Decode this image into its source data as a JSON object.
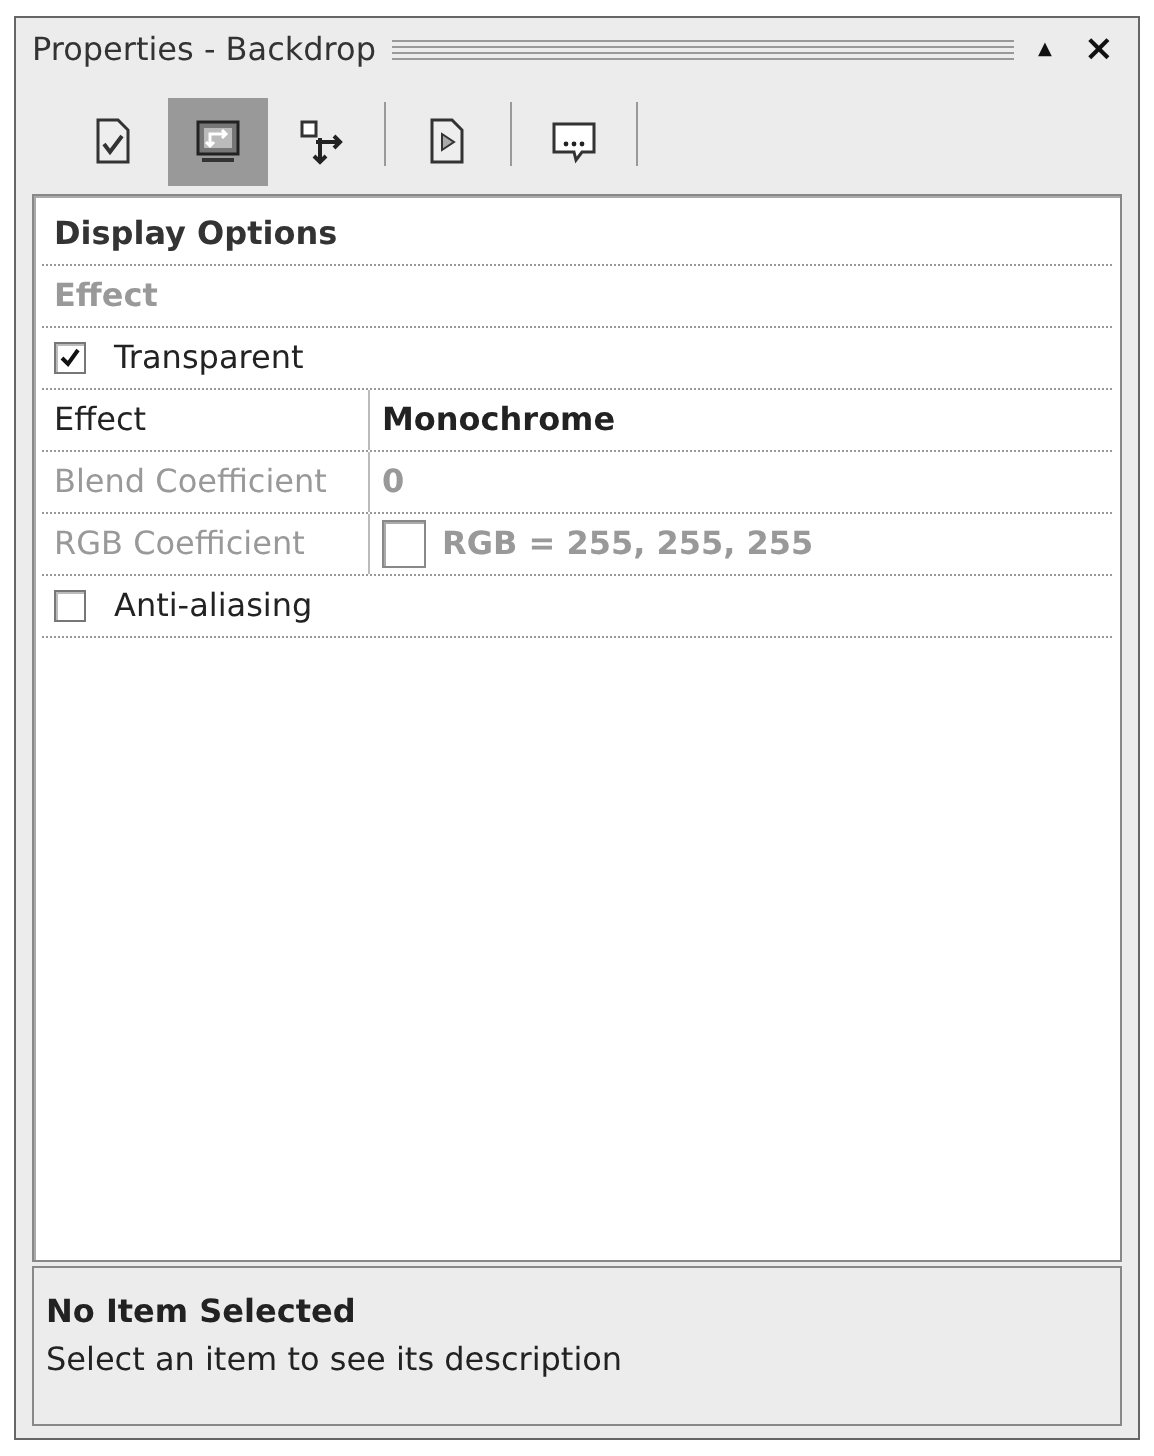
{
  "window": {
    "title": "Properties - Backdrop"
  },
  "title_buttons": [
    {
      "kind": "pin",
      "glyph": "▲"
    },
    {
      "kind": "close",
      "glyph": "×"
    }
  ],
  "toolbar": [
    {
      "kind": "doc-check",
      "selected": false
    },
    {
      "kind": "screen",
      "selected": true
    },
    {
      "kind": "move",
      "selected": false
    },
    {
      "kind": "doc-play",
      "selected": false
    },
    {
      "kind": "bubble",
      "selected": false
    }
  ],
  "grid": [
    {
      "kind": "category",
      "label": "Display Options"
    },
    {
      "kind": "subcategory",
      "label": "Effect"
    },
    {
      "kind": "checkbox",
      "label": "Transparent",
      "checked": true,
      "disabled": false
    },
    {
      "kind": "property",
      "label": "Effect",
      "value": "Monochrome",
      "disabled": false
    },
    {
      "kind": "property",
      "label": "Blend Coefficient",
      "value": "0",
      "disabled": true
    },
    {
      "kind": "color-property",
      "label": "RGB Coefficient",
      "value": "RGB = 255, 255, 255",
      "color": "#ffffff",
      "disabled": true
    },
    {
      "kind": "checkbox",
      "label": "Anti-aliasing",
      "checked": false,
      "disabled": false
    }
  ],
  "description": {
    "title": "No Item Selected",
    "text": "Select an item to see its description"
  }
}
